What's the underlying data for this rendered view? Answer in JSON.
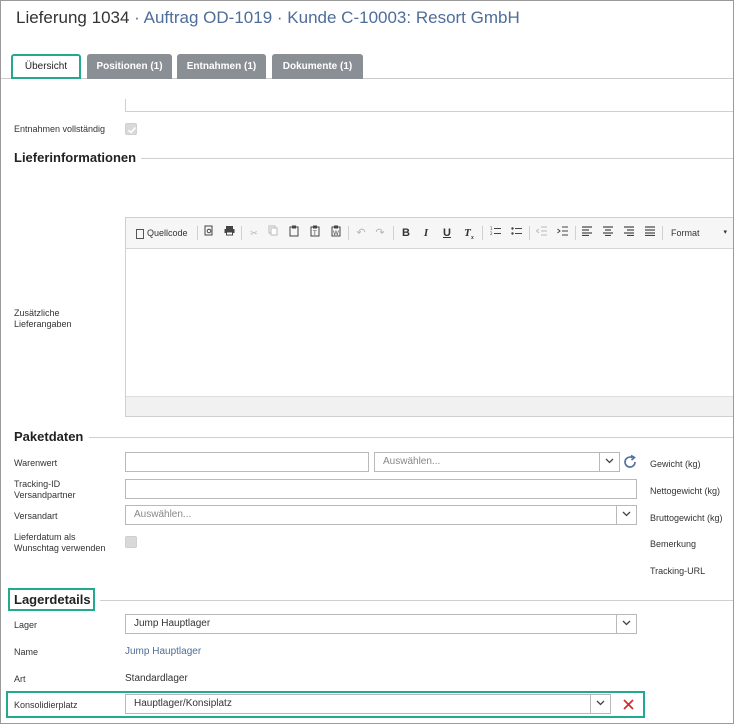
{
  "header": {
    "title": "Lieferung 1034",
    "sep": "·",
    "order_link": "Auftrag OD-1019",
    "customer_link": "Kunde C-10003: Resort GmbH"
  },
  "tabs": [
    {
      "label": "Übersicht",
      "active": true
    },
    {
      "label": "Positionen (1)",
      "active": false
    },
    {
      "label": "Entnahmen (1)",
      "active": false
    },
    {
      "label": "Dokumente (1)",
      "active": false
    }
  ],
  "overview": {
    "entnahmen_label": "Entnahmen vollständig",
    "entnahmen_checked": true
  },
  "lieferinfo": {
    "section_title": "Lieferinformationen",
    "zusatz_label_1": "Zusätzliche",
    "zusatz_label_2": "Lieferangaben",
    "toolbar": {
      "source_label": "Quellcode",
      "format_label": "Format",
      "bold_label": "B",
      "italic_label": "I",
      "underline_label": "U",
      "clear_label": "T"
    }
  },
  "paket": {
    "section_title": "Paketdaten",
    "warenwert_label": "Warenwert",
    "warenwert_value": "",
    "currency_placeholder": "Auswählen...",
    "tracking_label_1": "Tracking-ID",
    "tracking_label_2": "Versandpartner",
    "tracking_value": "",
    "versandart_label": "Versandart",
    "versandart_placeholder": "Auswählen...",
    "lieferdatum_label_1": "Lieferdatum als",
    "lieferdatum_label_2": "Wunschtag verwenden",
    "lieferdatum_checked": false,
    "right_labels": {
      "gewicht": "Gewicht (kg)",
      "netto": "Nettogewicht (kg)",
      "brutto": "Bruttogewicht (kg)",
      "bemerkung": "Bemerkung",
      "tracking_url": "Tracking-URL"
    }
  },
  "lager": {
    "section_title": "Lagerdetails",
    "lager_label": "Lager",
    "lager_value": "Jump Hauptlager",
    "name_label": "Name",
    "name_value": "Jump Hauptlager",
    "art_label": "Art",
    "art_value": "Standardlager",
    "konsolidier_label": "Konsolidierplatz",
    "konsolidier_value": "Hauptlager/Konsiplatz"
  },
  "colors": {
    "accent": "#23a98f",
    "link": "#4e6d99",
    "tab_inactive": "#8a8f96",
    "clear_red": "#d32f2f"
  }
}
